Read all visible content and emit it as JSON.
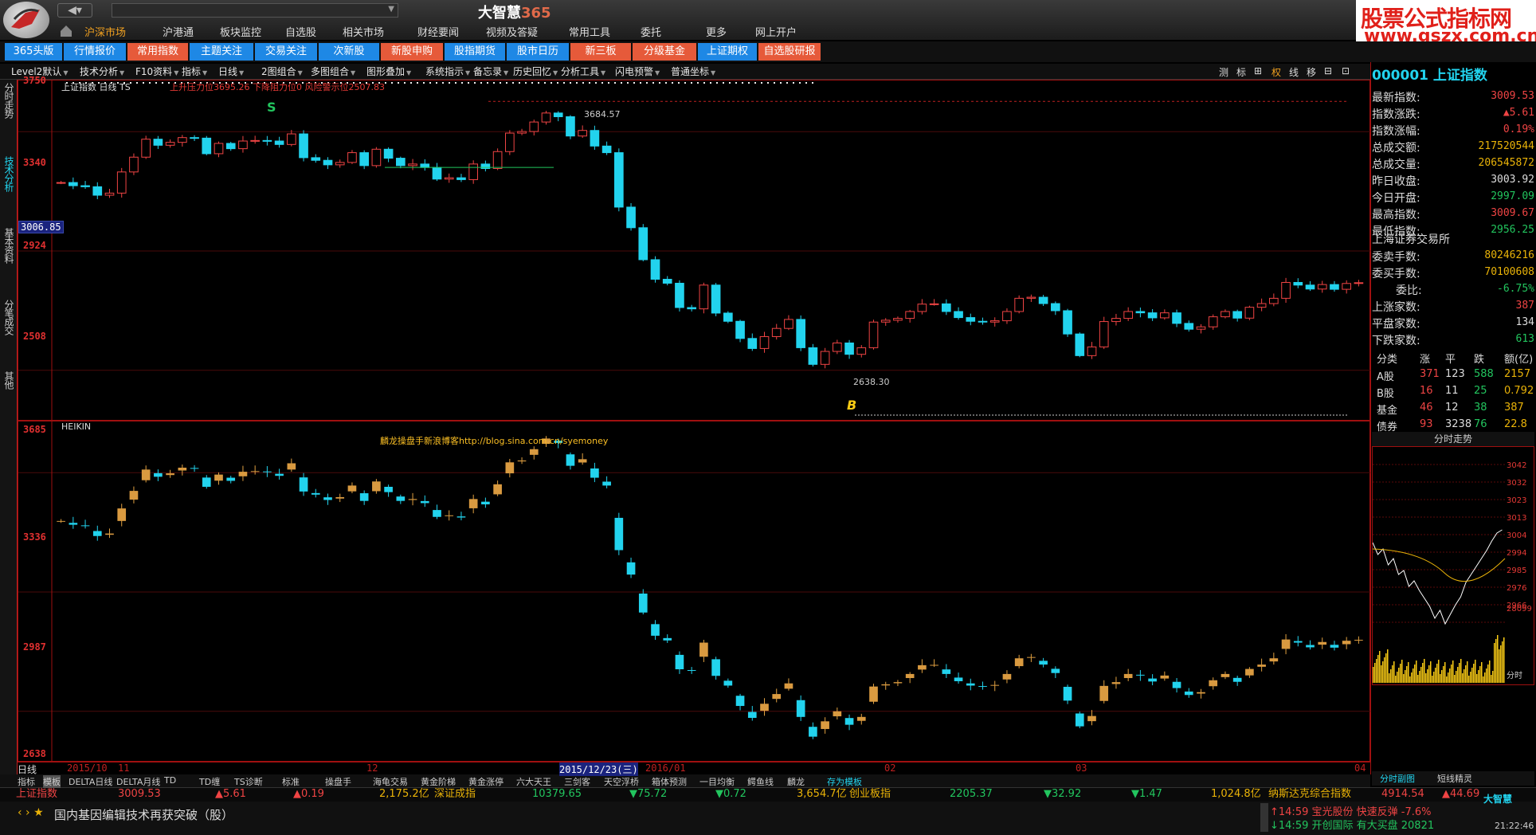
{
  "app": {
    "title": "大智慧",
    "title_num": "365",
    "nav_back": "◀▾"
  },
  "brand": {
    "line1": "股票公式指标网",
    "line2": "www.gszx.com.cn"
  },
  "main_menu": [
    {
      "label": "沪深市场",
      "active": true
    },
    {
      "label": "沪港通"
    },
    {
      "label": "板块监控"
    },
    {
      "label": "自选股"
    },
    {
      "label": "相关市场"
    },
    {
      "label": "财经要闻"
    },
    {
      "label": "视频及答疑"
    },
    {
      "label": "常用工具"
    },
    {
      "label": "委托"
    },
    {
      "label": "更多"
    },
    {
      "label": "网上开户"
    }
  ],
  "tabs": [
    {
      "label": "365头版",
      "color": "#1e88e5"
    },
    {
      "label": "行情报价",
      "color": "#1e88e5"
    },
    {
      "label": "常用指数",
      "color": "#e65a3a"
    },
    {
      "label": "主题关注",
      "color": "#1e88e5"
    },
    {
      "label": "交易关注",
      "color": "#1e88e5"
    },
    {
      "label": "次新股",
      "color": "#1e88e5"
    },
    {
      "label": "新股申购",
      "color": "#e65a3a"
    },
    {
      "label": "股指期货",
      "color": "#1e88e5"
    },
    {
      "label": "股市日历",
      "color": "#1e88e5"
    },
    {
      "label": "新三板",
      "color": "#e65a3a"
    },
    {
      "label": "分级基金",
      "color": "#e65a3a"
    },
    {
      "label": "上证期权",
      "color": "#1e88e5"
    },
    {
      "label": "自选股研报",
      "color": "#e65a3a"
    }
  ],
  "toolbar": [
    "Level2默认",
    "技术分析",
    "F10资料",
    "指标",
    "日线",
    "2图组合",
    "多图组合",
    "图形叠加",
    "系统指示",
    "备忘录",
    "历史回忆",
    "分析工具",
    "闪电预警",
    "普通坐标"
  ],
  "toolbar_right": [
    "测",
    "标",
    "⊞",
    "权",
    "线",
    "移",
    "⊟",
    "⊡"
  ],
  "left_tabs": [
    "分时走势",
    "技术分析",
    "基本资料",
    "分笔成交",
    "其他"
  ],
  "chart1": {
    "header": "上证指数 日线 TS",
    "header_red": "上升压力位3695.26  下降阻力位0  风险警示位2507.83",
    "y_labels": [
      "3750",
      "3340",
      "2924",
      "2508"
    ],
    "cursor_value": "3006.85",
    "high_label": "3684.57",
    "low_label": "2638.30",
    "signal_s": "S",
    "signal_b": "B"
  },
  "chart2": {
    "header": "HEIKIN",
    "watermark": "麟龙操盘手新浪博客http://blog.sina.com.cn/syemoney",
    "y_labels": [
      "3685",
      "3336",
      "2987",
      "2638"
    ]
  },
  "date_axis": {
    "labels": [
      "2015/10",
      "11",
      "12",
      "2015/12/23(三)",
      "2016/01",
      "02",
      "03",
      "04"
    ],
    "left": "日线"
  },
  "bottom_tabs": [
    "指标",
    "模板",
    "DELTA日线",
    "DELTA月线",
    "TD",
    "TD缠",
    "TS诊断",
    "标准",
    "操盘手",
    "海龟交易",
    "黄金阶梯",
    "黄金涨停",
    "六大天王",
    "三剑客",
    "天空浮桥",
    "箱体预测",
    "一目均衡",
    "鳄鱼线",
    "麟龙",
    "存为模板"
  ],
  "ticker": [
    {
      "t": "上证指数",
      "c": "#ef4444",
      "x": 20
    },
    {
      "t": "3009.53",
      "c": "#ef4444",
      "x": 148
    },
    {
      "t": "▲5.61",
      "c": "#ef4444",
      "x": 270
    },
    {
      "t": "▲0.19",
      "c": "#ef4444",
      "x": 368
    },
    {
      "t": "2,175.2亿",
      "c": "#eab308",
      "x": 476
    },
    {
      "t": "深证成指",
      "c": "#eab308",
      "x": 545
    },
    {
      "t": "10379.65",
      "c": "#22c55e",
      "x": 668
    },
    {
      "t": "▼75.72",
      "c": "#22c55e",
      "x": 790
    },
    {
      "t": "▼0.72",
      "c": "#22c55e",
      "x": 898
    },
    {
      "t": "3,654.7亿",
      "c": "#eab308",
      "x": 1000
    },
    {
      "t": "创业板指",
      "c": "#eab308",
      "x": 1066
    },
    {
      "t": "2205.37",
      "c": "#22c55e",
      "x": 1192
    },
    {
      "t": "▼32.92",
      "c": "#22c55e",
      "x": 1310
    },
    {
      "t": "▼1.47",
      "c": "#22c55e",
      "x": 1420
    },
    {
      "t": "1,024.8亿",
      "c": "#eab308",
      "x": 1520
    },
    {
      "t": "纳斯达克综合指数",
      "c": "#eab308",
      "x": 1592
    },
    {
      "t": "4914.54",
      "c": "#ef4444",
      "x": 1734
    },
    {
      "t": "▲44.69",
      "c": "#ef4444",
      "x": 1810
    }
  ],
  "news": "国内基因编辑技术再获突破（股）",
  "alerts": [
    "↑14:59 宝光股份 快速反弹 -7.6%",
    "↓14:59 开创国际 有大买盘 20821"
  ],
  "clock": "21:22:46",
  "status_brand": "大智慧",
  "right_panel": {
    "code": "000001 上证指数",
    "rows": [
      {
        "k": "最新指数:",
        "v": "3009.53",
        "c": "red"
      },
      {
        "k": "指数涨跌:",
        "v": "▲5.61",
        "c": "red"
      },
      {
        "k": "指数涨幅:",
        "v": "0.19%",
        "c": "red"
      },
      {
        "k": "总成交额:",
        "v": "217520544",
        "c": "yel"
      },
      {
        "k": "总成交量:",
        "v": "206545872",
        "c": "yel"
      },
      {
        "k": "昨日收盘:",
        "v": "3003.92",
        "c": "white"
      },
      {
        "k": "今日开盘:",
        "v": "2997.09",
        "c": "grn"
      },
      {
        "k": "最高指数:",
        "v": "3009.67",
        "c": "red"
      },
      {
        "k": "最低指数:",
        "v": "2956.25",
        "c": "grn"
      }
    ],
    "exchange": "上海证券交易所",
    "rows2": [
      {
        "k": "委卖手数:",
        "v": "80246216",
        "c": "yel"
      },
      {
        "k": "委买手数:",
        "v": "70100608",
        "c": "yel"
      },
      {
        "k": "委比:",
        "v": "-6.75%",
        "c": "grn"
      },
      {
        "k": "上涨家数:",
        "v": "387",
        "c": "red"
      },
      {
        "k": "平盘家数:",
        "v": "134",
        "c": "white"
      },
      {
        "k": "下跌家数:",
        "v": "613",
        "c": "grn"
      }
    ],
    "table_header": [
      "分类",
      "涨",
      "平",
      "跌",
      "额(亿)"
    ],
    "table": [
      [
        "A股",
        "371",
        "123",
        "588",
        "2157"
      ],
      [
        "B股",
        "16",
        "11",
        "25",
        "0.792"
      ],
      [
        "基金",
        "46",
        "12",
        "38",
        "387"
      ],
      [
        "债券",
        "93",
        "3238",
        "76",
        "22.8"
      ]
    ],
    "mini_title": "分时走势",
    "mini_labels": [
      "3042",
      "3032",
      "3023",
      "3013",
      "3004",
      "2994",
      "2985",
      "2976",
      "2966",
      "28099",
      "分时"
    ],
    "bottom_tabs": [
      "分时副图",
      "短线精灵"
    ]
  },
  "chart_data": {
    "type": "candlestick",
    "series": [
      {
        "name": "上证指数",
        "values": [
          3388,
          3376,
          3372,
          3340,
          3348,
          3428,
          3484,
          3552,
          3529,
          3540,
          3558,
          3556,
          3497,
          3536,
          3516,
          3545,
          3547,
          3545,
          3532,
          3572,
          3482,
          3472,
          3455,
          3464,
          3501,
          3452,
          3514,
          3480,
          3452,
          3458,
          3445,
          3401,
          3406,
          3399,
          3458,
          3441,
          3505,
          3575,
          3581,
          3617,
          3651,
          3637,
          3564,
          3585,
          3526,
          3501,
          3295,
          3217,
          3096,
          3022,
          3007,
          2915,
          2910,
          3000,
          2894,
          2863,
          2798,
          2760,
          2805,
          2836,
          2870,
          2763,
          2700,
          2749,
          2781,
          2738,
          2763,
          2860,
          2867,
          2874,
          2900,
          2928,
          2929,
          2900,
          2877,
          2863,
          2860,
          2865,
          2900,
          2950,
          2954,
          2930,
          2903,
          2815,
          2733,
          2766,
          2862,
          2874,
          2900,
          2895,
          2876,
          2895,
          2855,
          2833,
          2842,
          2880,
          2900,
          2875,
          2916,
          2930,
          2950,
          3010,
          3000,
          2985,
          3002,
          2984,
          3006,
          3009
        ]
      }
    ]
  }
}
